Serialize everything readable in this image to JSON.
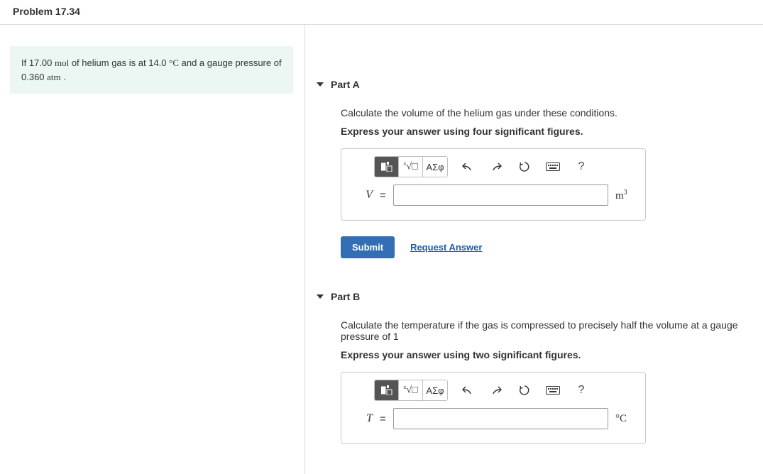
{
  "header": {
    "title": "Problem 17.34"
  },
  "left": {
    "statement_prefix": "If 17.00 ",
    "mol_unit": "mol",
    "statement_mid1": " of helium gas is at 14.0 ",
    "degC": "°C",
    "statement_mid2": " and a gauge pressure of 0.360 ",
    "atm_unit": "atm",
    "statement_suffix": " ."
  },
  "parts": [
    {
      "label": "Part A",
      "prompt": "Calculate the volume of the helium gas under these conditions.",
      "sigfig": "Express your answer using four significant figures.",
      "var": "V",
      "unit_html": "m³",
      "input_value": "",
      "toolbar": {
        "template_title": "Insert template",
        "greek_label": "ΑΣφ",
        "undo": "undo",
        "redo": "redo",
        "reset": "reset",
        "keyboard": "keyboard",
        "help": "?"
      },
      "submit_label": "Submit",
      "request_label": "Request Answer"
    },
    {
      "label": "Part B",
      "prompt": "Calculate the temperature if the gas is compressed to precisely half the volume at a gauge pressure of 1",
      "sigfig": "Express your answer using two significant figures.",
      "var": "T",
      "unit_html": "°C",
      "input_value": "",
      "toolbar": {
        "template_title": "Insert template",
        "greek_label": "ΑΣφ",
        "undo": "undo",
        "redo": "redo",
        "reset": "reset",
        "keyboard": "keyboard",
        "help": "?"
      },
      "submit_label": "Submit",
      "request_label": "Request Answer"
    }
  ]
}
